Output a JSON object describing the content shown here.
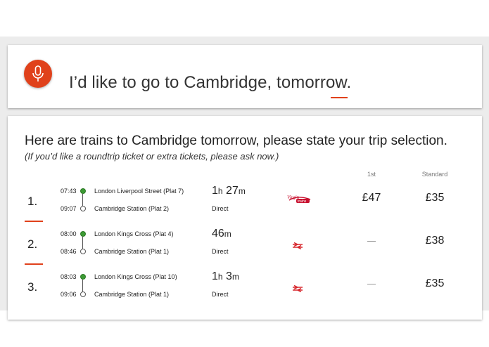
{
  "voice": {
    "query": "I’d like to go to Cambridge, tomorrow."
  },
  "results": {
    "heading": "Here are trains to Cambridge tomorrow, please state your trip selection.",
    "subheading": "(If you’d like a roundtrip ticket or extra tickets, please ask now.)",
    "columns": {
      "first": "1st",
      "standard": "Standard"
    },
    "trips": [
      {
        "index": "1.",
        "dep_time": "07:43",
        "dep_station": "London Liverpool Street (Plat 7)",
        "arr_time": "09:07",
        "arr_station": "Cambridge Station (Plat 2)",
        "dur_h": "1",
        "dur_h_unit": "h",
        "dur_m": "27",
        "dur_m_unit": "m",
        "type": "Direct",
        "operator_icon": "virgin-trains-logo",
        "first_price": "£47",
        "standard_price": "£35"
      },
      {
        "index": "2.",
        "dep_time": "08:00",
        "dep_station": "London Kings Cross (Plat 4)",
        "arr_time": "08:46",
        "arr_station": "Cambridge Station (Plat 1)",
        "dur_h": "",
        "dur_h_unit": "",
        "dur_m": "46",
        "dur_m_unit": "m",
        "type": "Direct",
        "operator_icon": "national-rail-icon",
        "first_price": "",
        "standard_price": "£38"
      },
      {
        "index": "3.",
        "dep_time": "08:03",
        "dep_station": "London Kings Cross (Plat 10)",
        "arr_time": "09:06",
        "arr_station": "Cambridge Station (Plat 1)",
        "dur_h": "1",
        "dur_h_unit": "h",
        "dur_m": "3",
        "dur_m_unit": "m",
        "type": "Direct",
        "operator_icon": "national-rail-icon",
        "first_price": "",
        "standard_price": "£35"
      }
    ]
  },
  "colors": {
    "accent": "#e0411b",
    "green_dot": "#3d9b35"
  }
}
